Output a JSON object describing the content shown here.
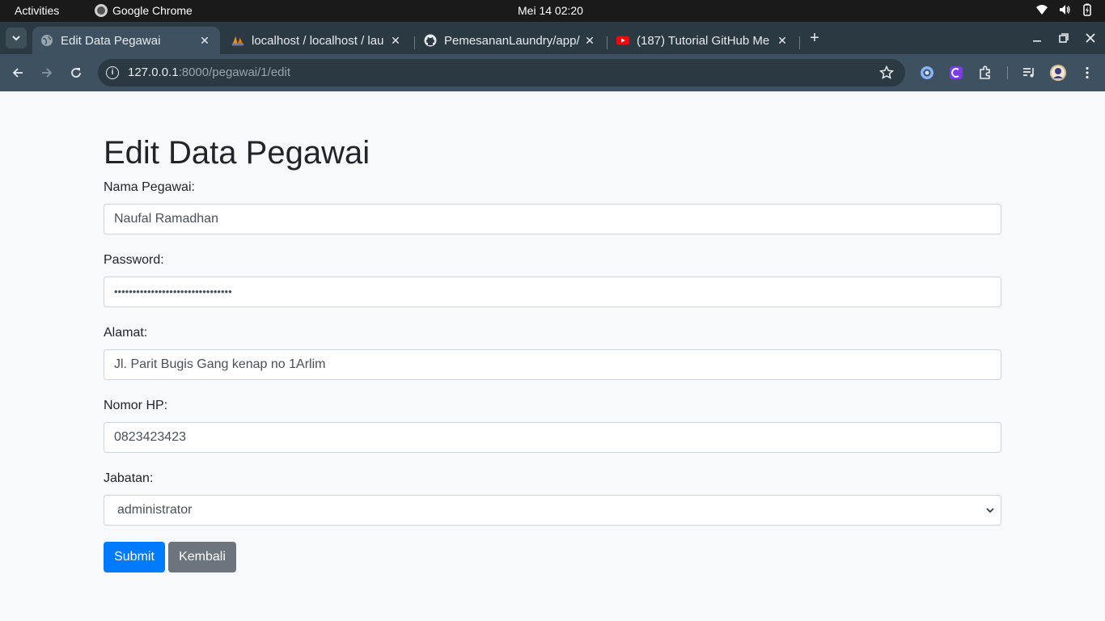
{
  "system": {
    "activities": "Activities",
    "app_name": "Google Chrome",
    "clock": "Mei 14  02:20"
  },
  "tabs": [
    {
      "title": "Edit Data Pegawai",
      "favicon": "globe-icon"
    },
    {
      "title": "localhost / localhost / lau",
      "favicon": "phpmyadmin-icon"
    },
    {
      "title": "PemesananLaundry/app/",
      "favicon": "github-icon"
    },
    {
      "title": "(187) Tutorial GitHub Me",
      "favicon": "youtube-icon"
    }
  ],
  "address_bar": {
    "host": "127.0.0.1",
    "path": ":8000/pegawai/1/edit"
  },
  "page": {
    "heading": "Edit Data Pegawai",
    "fields": {
      "nama": {
        "label": "Nama Pegawai:",
        "value": "Naufal Ramadhan"
      },
      "password": {
        "label": "Password:",
        "value": "••••••••••••••••••••••••••••••••"
      },
      "alamat": {
        "label": "Alamat:",
        "value": "Jl. Parit Bugis Gang kenap no 1Arlim"
      },
      "nomor_hp": {
        "label": "Nomor HP:",
        "value": "0823423423"
      },
      "jabatan": {
        "label": "Jabatan:",
        "value": "administrator"
      }
    },
    "buttons": {
      "submit": "Submit",
      "kembali": "Kembali"
    }
  },
  "colors": {
    "primary": "#007bff",
    "secondary": "#6c757d",
    "chrome_frame": "#2b3a42",
    "chrome_toolbar": "#3d5160"
  }
}
